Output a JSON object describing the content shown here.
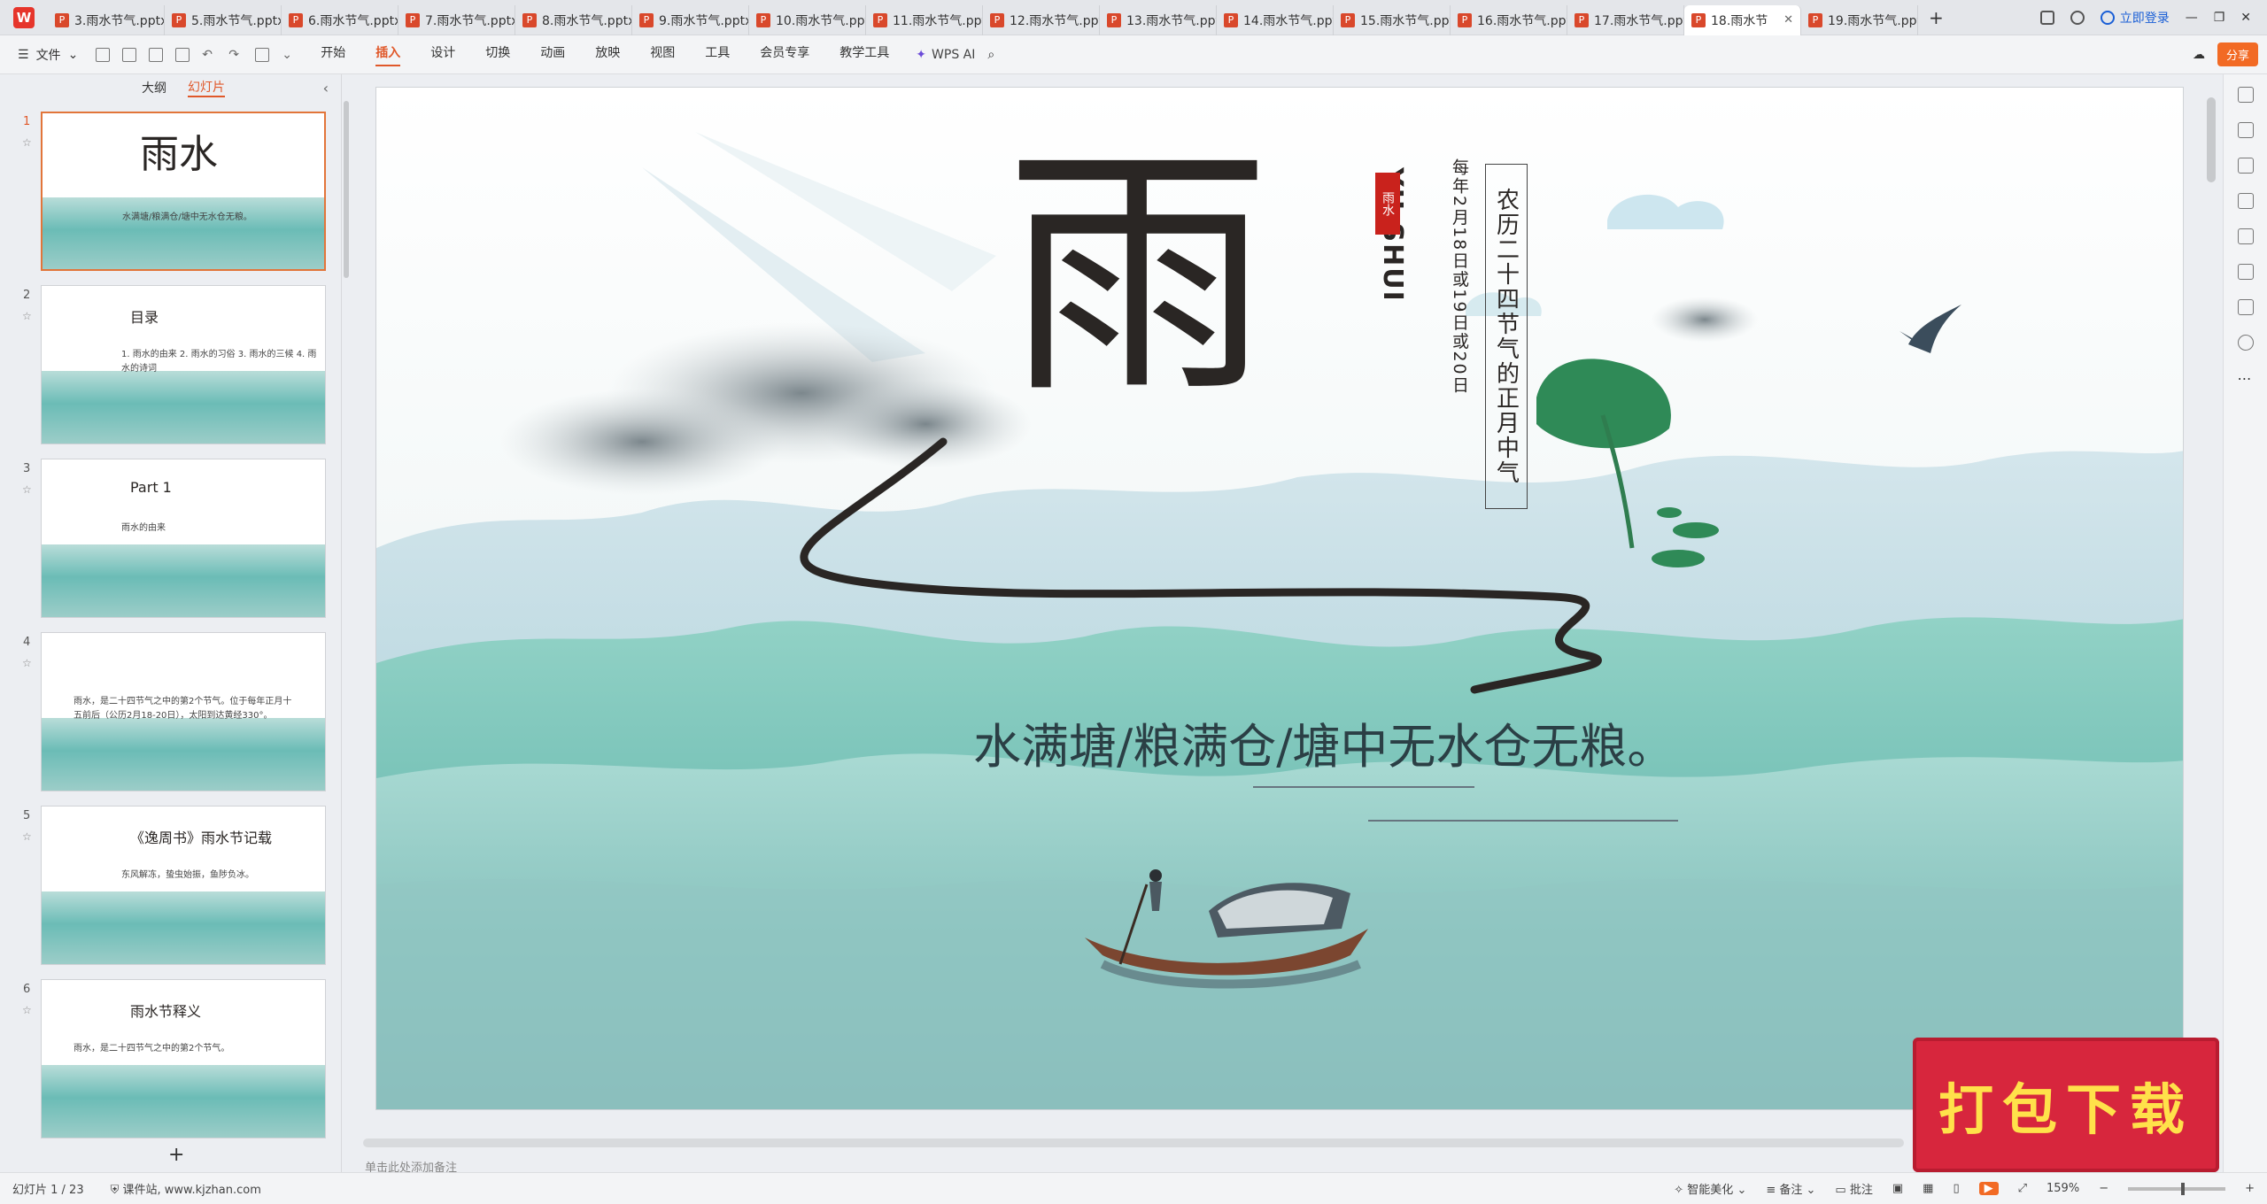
{
  "app": {
    "logo_letter": "W"
  },
  "tabs": [
    {
      "label": "3.雨水节气.pptx",
      "active": false
    },
    {
      "label": "5.雨水节气.pptx",
      "active": false
    },
    {
      "label": "6.雨水节气.pptx",
      "active": false
    },
    {
      "label": "7.雨水节气.pptx",
      "active": false
    },
    {
      "label": "8.雨水节气.pptx",
      "active": false
    },
    {
      "label": "9.雨水节气.pptx",
      "active": false
    },
    {
      "label": "10.雨水节气.ppt",
      "active": false
    },
    {
      "label": "11.雨水节气.ppt",
      "active": false
    },
    {
      "label": "12.雨水节气.ppt",
      "active": false
    },
    {
      "label": "13.雨水节气.ppt",
      "active": false
    },
    {
      "label": "14.雨水节气.ppt",
      "active": false
    },
    {
      "label": "15.雨水节气.ppt",
      "active": false
    },
    {
      "label": "16.雨水节气.ppt",
      "active": false
    },
    {
      "label": "17.雨水节气.ppt",
      "active": false
    },
    {
      "label": "18.雨水节",
      "active": true
    },
    {
      "label": "19.雨水节气.ppt",
      "active": false
    }
  ],
  "tabbar": {
    "add": "+",
    "login": "立即登录"
  },
  "menubar": {
    "file": "文件",
    "menus": [
      "开始",
      "插入",
      "设计",
      "切换",
      "动画",
      "放映",
      "视图",
      "工具",
      "会员专享",
      "教学工具"
    ],
    "active_menu": "插入",
    "wps_ai": "WPS AI",
    "share": "分享"
  },
  "leftpanel": {
    "tabs": [
      "大纲",
      "幻灯片"
    ],
    "active_tab": "幻灯片",
    "add": "+",
    "thumbs": [
      {
        "num": "1",
        "title": "雨水",
        "sub": "水满塘/粮满仓/塘中无水仓无粮。"
      },
      {
        "num": "2",
        "title": "目录",
        "sub": "1. 雨水的由来   2. 雨水的习俗   3. 雨水的三候   4. 雨水的诗词"
      },
      {
        "num": "3",
        "title": "Part 1",
        "sub": "雨水的由来"
      },
      {
        "num": "4",
        "title": "",
        "sub": "雨水，是二十四节气之中的第2个节气。位于每年正月十五前后（公历2月18-20日），太阳到达黄经330°。"
      },
      {
        "num": "5",
        "title": "《逸周书》雨水节记载",
        "sub": "东风解冻，蛰虫始振，鱼陟负冰。"
      },
      {
        "num": "6",
        "title": "雨水节释义",
        "sub": "雨水，是二十四节气之中的第2个节气。"
      }
    ]
  },
  "slide": {
    "big_char": "雨",
    "pinyin": "YU SHUI",
    "seal": "雨水",
    "date_line": "每年2月18日或19日或20日",
    "subtitle_vertical": "农历二十四节气的正月中气",
    "main_text": "水满塘/粮满仓/塘中无水仓无粮。",
    "notes_placeholder": "单击此处添加备注"
  },
  "statusbar": {
    "slide_info": "幻灯片 1 / 23",
    "site": "课件站, www.kjzhan.com",
    "beautify": "智能美化",
    "notes": "备注",
    "comments": "批注",
    "zoom": "159%"
  },
  "download_badge": "打包下载",
  "colors": {
    "accent": "#e0582a",
    "badge_red": "#d7263d",
    "badge_text": "#ffe14a",
    "sea": "#6bbcb6"
  }
}
